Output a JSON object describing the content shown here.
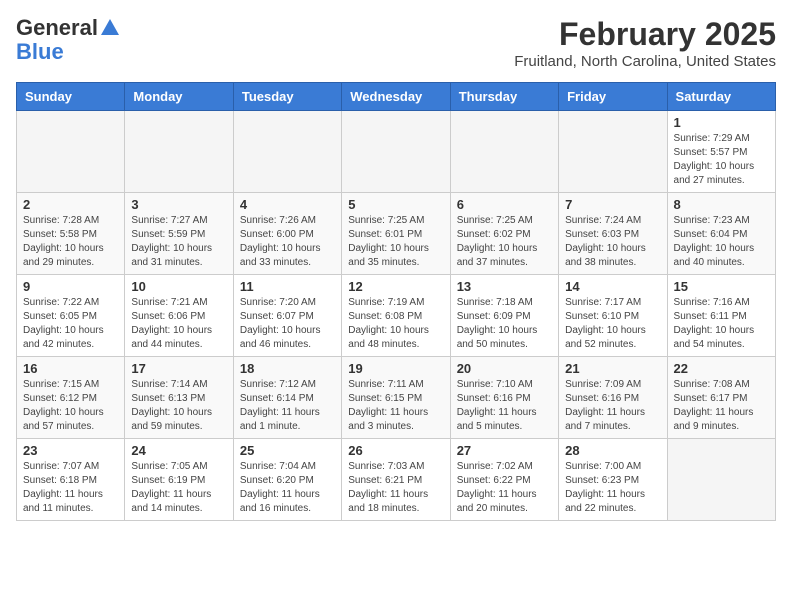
{
  "header": {
    "logo_general": "General",
    "logo_blue": "Blue",
    "month": "February 2025",
    "location": "Fruitland, North Carolina, United States"
  },
  "days_of_week": [
    "Sunday",
    "Monday",
    "Tuesday",
    "Wednesday",
    "Thursday",
    "Friday",
    "Saturday"
  ],
  "weeks": [
    [
      {
        "day": "",
        "info": ""
      },
      {
        "day": "",
        "info": ""
      },
      {
        "day": "",
        "info": ""
      },
      {
        "day": "",
        "info": ""
      },
      {
        "day": "",
        "info": ""
      },
      {
        "day": "",
        "info": ""
      },
      {
        "day": "1",
        "info": "Sunrise: 7:29 AM\nSunset: 5:57 PM\nDaylight: 10 hours and 27 minutes."
      }
    ],
    [
      {
        "day": "2",
        "info": "Sunrise: 7:28 AM\nSunset: 5:58 PM\nDaylight: 10 hours and 29 minutes."
      },
      {
        "day": "3",
        "info": "Sunrise: 7:27 AM\nSunset: 5:59 PM\nDaylight: 10 hours and 31 minutes."
      },
      {
        "day": "4",
        "info": "Sunrise: 7:26 AM\nSunset: 6:00 PM\nDaylight: 10 hours and 33 minutes."
      },
      {
        "day": "5",
        "info": "Sunrise: 7:25 AM\nSunset: 6:01 PM\nDaylight: 10 hours and 35 minutes."
      },
      {
        "day": "6",
        "info": "Sunrise: 7:25 AM\nSunset: 6:02 PM\nDaylight: 10 hours and 37 minutes."
      },
      {
        "day": "7",
        "info": "Sunrise: 7:24 AM\nSunset: 6:03 PM\nDaylight: 10 hours and 38 minutes."
      },
      {
        "day": "8",
        "info": "Sunrise: 7:23 AM\nSunset: 6:04 PM\nDaylight: 10 hours and 40 minutes."
      }
    ],
    [
      {
        "day": "9",
        "info": "Sunrise: 7:22 AM\nSunset: 6:05 PM\nDaylight: 10 hours and 42 minutes."
      },
      {
        "day": "10",
        "info": "Sunrise: 7:21 AM\nSunset: 6:06 PM\nDaylight: 10 hours and 44 minutes."
      },
      {
        "day": "11",
        "info": "Sunrise: 7:20 AM\nSunset: 6:07 PM\nDaylight: 10 hours and 46 minutes."
      },
      {
        "day": "12",
        "info": "Sunrise: 7:19 AM\nSunset: 6:08 PM\nDaylight: 10 hours and 48 minutes."
      },
      {
        "day": "13",
        "info": "Sunrise: 7:18 AM\nSunset: 6:09 PM\nDaylight: 10 hours and 50 minutes."
      },
      {
        "day": "14",
        "info": "Sunrise: 7:17 AM\nSunset: 6:10 PM\nDaylight: 10 hours and 52 minutes."
      },
      {
        "day": "15",
        "info": "Sunrise: 7:16 AM\nSunset: 6:11 PM\nDaylight: 10 hours and 54 minutes."
      }
    ],
    [
      {
        "day": "16",
        "info": "Sunrise: 7:15 AM\nSunset: 6:12 PM\nDaylight: 10 hours and 57 minutes."
      },
      {
        "day": "17",
        "info": "Sunrise: 7:14 AM\nSunset: 6:13 PM\nDaylight: 10 hours and 59 minutes."
      },
      {
        "day": "18",
        "info": "Sunrise: 7:12 AM\nSunset: 6:14 PM\nDaylight: 11 hours and 1 minute."
      },
      {
        "day": "19",
        "info": "Sunrise: 7:11 AM\nSunset: 6:15 PM\nDaylight: 11 hours and 3 minutes."
      },
      {
        "day": "20",
        "info": "Sunrise: 7:10 AM\nSunset: 6:16 PM\nDaylight: 11 hours and 5 minutes."
      },
      {
        "day": "21",
        "info": "Sunrise: 7:09 AM\nSunset: 6:16 PM\nDaylight: 11 hours and 7 minutes."
      },
      {
        "day": "22",
        "info": "Sunrise: 7:08 AM\nSunset: 6:17 PM\nDaylight: 11 hours and 9 minutes."
      }
    ],
    [
      {
        "day": "23",
        "info": "Sunrise: 7:07 AM\nSunset: 6:18 PM\nDaylight: 11 hours and 11 minutes."
      },
      {
        "day": "24",
        "info": "Sunrise: 7:05 AM\nSunset: 6:19 PM\nDaylight: 11 hours and 14 minutes."
      },
      {
        "day": "25",
        "info": "Sunrise: 7:04 AM\nSunset: 6:20 PM\nDaylight: 11 hours and 16 minutes."
      },
      {
        "day": "26",
        "info": "Sunrise: 7:03 AM\nSunset: 6:21 PM\nDaylight: 11 hours and 18 minutes."
      },
      {
        "day": "27",
        "info": "Sunrise: 7:02 AM\nSunset: 6:22 PM\nDaylight: 11 hours and 20 minutes."
      },
      {
        "day": "28",
        "info": "Sunrise: 7:00 AM\nSunset: 6:23 PM\nDaylight: 11 hours and 22 minutes."
      },
      {
        "day": "",
        "info": ""
      }
    ]
  ]
}
